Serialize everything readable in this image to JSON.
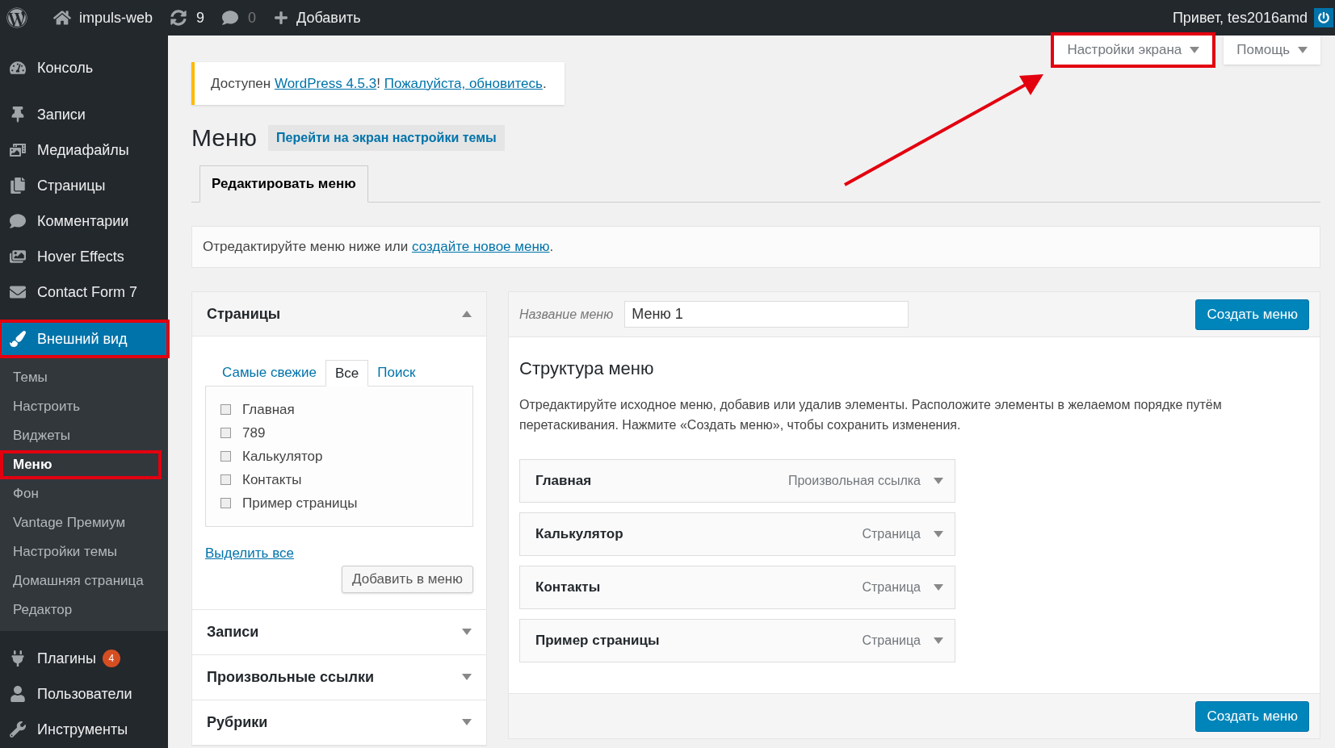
{
  "admin_bar": {
    "site": "impuls-web",
    "updates": "9",
    "comments": "0",
    "new": "Добавить",
    "greeting": "Привет, tes2016amd"
  },
  "sidebar": {
    "items": [
      {
        "label": "Консоль",
        "selected": false,
        "highlighted": false
      },
      {
        "label": "Записи",
        "selected": false,
        "highlighted": false
      },
      {
        "label": "Медиафайлы",
        "selected": false,
        "highlighted": false
      },
      {
        "label": "Страницы",
        "selected": false,
        "highlighted": false
      },
      {
        "label": "Комментарии",
        "selected": false,
        "highlighted": false
      },
      {
        "label": "Hover Effects",
        "selected": false,
        "highlighted": false
      },
      {
        "label": "Contact Form 7",
        "selected": false,
        "highlighted": false
      },
      {
        "label": "Внешний вид",
        "selected": true,
        "highlighted": true,
        "children": [
          {
            "label": "Темы",
            "selected": false,
            "highlighted": false
          },
          {
            "label": "Настроить",
            "selected": false,
            "highlighted": false
          },
          {
            "label": "Виджеты",
            "selected": false,
            "highlighted": false
          },
          {
            "label": "Меню",
            "selected": true,
            "highlighted": true
          },
          {
            "label": "Фон",
            "selected": false,
            "highlighted": false
          },
          {
            "label": "Vantage Премиум",
            "selected": false,
            "highlighted": false
          },
          {
            "label": "Настройки темы",
            "selected": false,
            "highlighted": false
          },
          {
            "label": "Домашняя страница",
            "selected": false,
            "highlighted": false
          },
          {
            "label": "Редактор",
            "selected": false,
            "highlighted": false
          }
        ]
      },
      {
        "label": "Плагины",
        "selected": false,
        "highlighted": false,
        "badge": "4"
      },
      {
        "label": "Пользователи",
        "selected": false,
        "highlighted": false
      },
      {
        "label": "Инструменты",
        "selected": false,
        "highlighted": false
      }
    ]
  },
  "screen_tabs": [
    {
      "label": "Настройки экрана",
      "highlighted": true
    },
    {
      "label": "Помощь",
      "highlighted": false
    }
  ],
  "notice": {
    "before": "Доступен",
    "link_1": "WordPress 4.5.3",
    "between": "!",
    "link_2": "Пожалуйста, обновитесь",
    "after": "."
  },
  "page": {
    "title": "Меню",
    "title_action": "Перейти на экран настройки темы",
    "tabs": [
      {
        "label": "Редактировать меню",
        "selected": true
      }
    ]
  },
  "description": {
    "text": "Отредактируйте меню ниже или",
    "link": "создайте новое меню",
    "after": "."
  },
  "accordion": [
    {
      "title": "Страницы",
      "expanded": true,
      "tabs": [
        {
          "label": "Самые свежие",
          "selected": false
        },
        {
          "label": "Все",
          "selected": true
        },
        {
          "label": "Поиск",
          "selected": false
        }
      ],
      "items": [
        {
          "label": "Главная",
          "checked": false
        },
        {
          "label": "789",
          "checked": false
        },
        {
          "label": "Калькулятор",
          "checked": false
        },
        {
          "label": "Контакты",
          "checked": false
        },
        {
          "label": "Пример страницы",
          "checked": false
        }
      ],
      "select_all": "Выделить все",
      "add_button": "Добавить в меню"
    },
    {
      "title": "Записи",
      "expanded": false
    },
    {
      "title": "Произвольные ссылки",
      "expanded": false
    },
    {
      "title": "Рубрики",
      "expanded": false
    }
  ],
  "menu_editor": {
    "name_label": "Название меню",
    "name_value": "Меню 1",
    "save_button": "Создать меню",
    "structure_title": "Структура меню",
    "structure_text": "Отредактируйте исходное меню, добавив или удалив элементы. Расположите элементы в желаемом порядке путём перетаскивания. Нажмите «Создать меню», чтобы сохранить изменения.",
    "items": [
      {
        "title": "Главная",
        "type": "Произвольная ссылка",
        "expanded": false
      },
      {
        "title": "Калькулятор",
        "type": "Страница",
        "expanded": false
      },
      {
        "title": "Контакты",
        "type": "Страница",
        "expanded": false
      },
      {
        "title": "Пример страницы",
        "type": "Страница",
        "expanded": false
      }
    ],
    "footer_button": "Создать меню"
  },
  "annotation": {
    "arrow": true
  }
}
